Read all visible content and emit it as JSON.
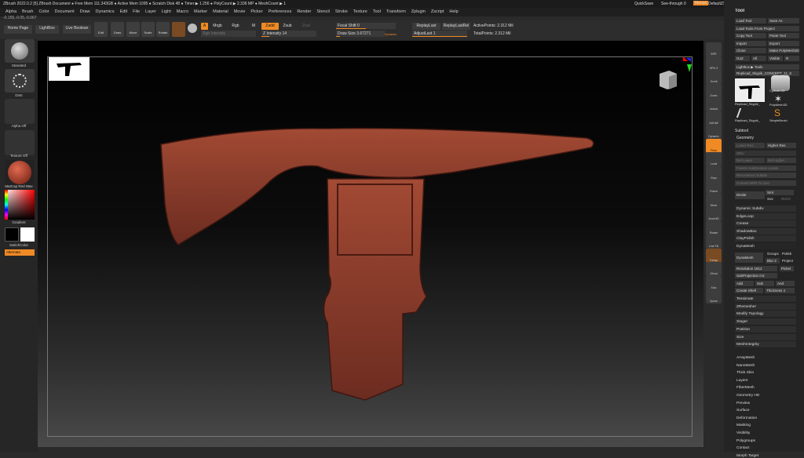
{
  "titlebar": {
    "text": "ZBrush 2022.0.2 [5]   ZBrush Document   ● Free Mem 111.343GB ● Active Mem 1095 ● Scratch Disk 48 ● Timer ▶ 1.256 ● PolyCount ▶ 2.336 MP ● MeshCount ▶ 1",
    "quicksave": "QuickSave",
    "seethrough": "See-through  0",
    "menus": "Menus",
    "script": "DefaultZScript"
  },
  "menubar": [
    "Alpha",
    "Brush",
    "Color",
    "Document",
    "Draw",
    "Dynamics",
    "Edit",
    "File",
    "Layer",
    "Light",
    "Macro",
    "Marker",
    "Material",
    "Movie",
    "Picker",
    "Preferences",
    "Render",
    "Stencil",
    "Stroke",
    "Texture",
    "Tool",
    "Transform",
    "Zplugin",
    "Zscript",
    "Help"
  ],
  "coords": "-0.155,-0.05,-0.067",
  "toolbar": {
    "home": "Home Page",
    "lightbox": "LightBox",
    "liveboolean": "Live Boolean",
    "edit": "Edit",
    "draw": "Draw",
    "move": "Move",
    "scale": "Scale",
    "rotate": "Rotate",
    "a": "A",
    "mrgb": "Mrgb",
    "rgb": "Rgb",
    "m": "M",
    "zadd": "Zadd",
    "zsub": "Zsub",
    "zcut": "Zcut",
    "rgbintensity": "Rgb Intensity",
    "zintensity": "Z Intensity 14",
    "focal": "Focal Shift 0",
    "drawsize": "Draw Size 3.67271",
    "dynamic": "Dynamic",
    "replaylast": "ReplayLast",
    "replaylastrel": "ReplayLastRel",
    "activepoints": "ActivePoints: 2.312 Mil",
    "adjustlast": "AdjustLast 1",
    "totalpoints": "TotalPoints: 2.312 Mil"
  },
  "leftpanel": {
    "standard": "Standard",
    "dots": "Dots",
    "alphaoff": "Alpha Off",
    "textureoff": "Texture Off",
    "material": "MatCap Red Wax",
    "gradient": "Gradient",
    "switchcolor": "SwitchColor",
    "alternate": "Alternate"
  },
  "rightstrip": [
    "BPR",
    "SPix 3",
    "Scroll",
    "Zoom",
    "Actual",
    "AAHalf",
    "Dynamic Persp",
    "Floor",
    "Local",
    "Gxyz",
    "Frame",
    "Move",
    "Zoom3D",
    "Rotate",
    "Line Fill PolyF",
    "Transp",
    "Ghost",
    "Solo",
    "Xpose"
  ],
  "toolpanel": {
    "title": "Tool",
    "buttons": [
      [
        "Load Tool",
        "Save As"
      ],
      [
        "Load Tools From Project",
        ""
      ],
      [
        "Copy Tool",
        "Paste Tool"
      ],
      [
        "Import",
        "Export"
      ],
      [
        "Clone",
        "Make PolyMesh3D"
      ],
      [
        "GoZ",
        "All",
        "Visible",
        "R"
      ]
    ],
    "lightbox": "Lightbox ▶ Tools",
    "current": "Replicad_Skypik_CONCEPT_11_0",
    "thumbs": [
      "Replicad_Skypik_",
      "Cylinder3D",
      "",
      "PolyMesh3D",
      "Replicad_Skypik_",
      "SimpleBrush"
    ],
    "subtool": "Subtool",
    "geometry": "Geometry",
    "geo": [
      [
        "Lower Res",
        "Higher Res"
      ],
      [
        "SDiv",
        ""
      ],
      [
        "Del Lower",
        "Del Higher"
      ],
      [
        "Freeze SubDivision Levels",
        ""
      ],
      [
        "Reconstruct Subdiv",
        ""
      ],
      [
        "Convert BPR To Geo",
        ""
      ]
    ],
    "divide": "Divide",
    "smt": "Smt",
    "suv": "Suv",
    "reuv": "ReUV",
    "items1": [
      "Dynamic Subdiv",
      "EdgeLoop",
      "Crease",
      "ShadowBox",
      "ClayPolish"
    ],
    "dynamesh": "DynaMesh",
    "dm": {
      "dynamesh": "DynaMesh",
      "groups": "Groups",
      "polish": "Polish",
      "blur": "Blur 2",
      "project": "Project",
      "resolution": "Resolution 1812",
      "picker": "Picker",
      "subproj": "SubProjection 0.6",
      "add": "Add",
      "sub": "Sub",
      "and": "And",
      "createshell": "Create Shell",
      "thickness": "Thickness 4"
    },
    "items2": [
      "Tessimate",
      "ZRemesher",
      "Modify Topology",
      "Stager",
      "Position",
      "Size",
      "MeshIntegrity"
    ],
    "menu": [
      "ArrayMesh",
      "NanoMesh",
      "Thick Skin",
      "Layers",
      "FiberMesh",
      "Geometry HD",
      "Preview",
      "Surface",
      "Deformation",
      "Masking",
      "Visibility",
      "Polygroups",
      "Contact",
      "Morph Target"
    ]
  },
  "colors": {
    "accent": "#f08a24",
    "mesh": "#8a3a2a"
  }
}
